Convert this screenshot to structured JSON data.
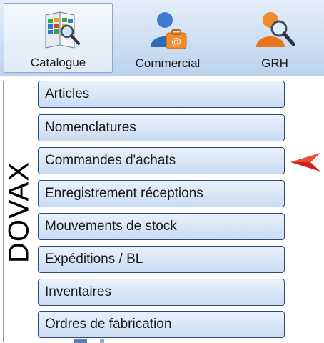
{
  "ribbon": {
    "buttons": [
      {
        "label": "Catalogue",
        "icon": "catalogue-book-icon",
        "active": true
      },
      {
        "label": "Commercial",
        "icon": "commercial-user-icon",
        "active": false
      },
      {
        "label": "GRH",
        "icon": "grh-user-search-icon",
        "active": false
      }
    ]
  },
  "brand": {
    "text": "DOVAX"
  },
  "menu": {
    "items": [
      {
        "label": "Articles"
      },
      {
        "label": "Nomenclatures"
      },
      {
        "label": "Commandes d'achats"
      },
      {
        "label": "Enregistrement réceptions"
      },
      {
        "label": "Mouvements de stock"
      },
      {
        "label": "Expéditions / BL"
      },
      {
        "label": "Inventaires"
      },
      {
        "label": "Ordres de fabrication"
      }
    ]
  },
  "pointer": {
    "icon": "red-arrow-pointer-icon",
    "color": "#d42020"
  },
  "colors": {
    "ribbon_bg": "#cddff3",
    "button_border": "#2e4c78",
    "button_bg": "#dce8f6"
  }
}
